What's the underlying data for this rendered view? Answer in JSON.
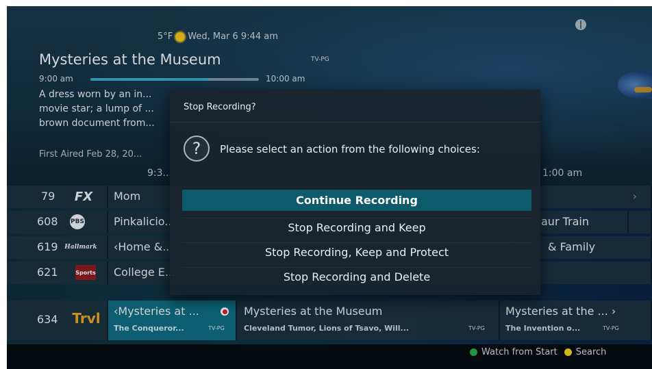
{
  "header": {
    "temperature": "5°F",
    "date_time": "Wed, Mar 6 9:44 am",
    "title": "Mysteries at the Museum",
    "rating": "TV-PG",
    "start_time": "9:00 am",
    "end_time": "10:00 am",
    "progress_fraction": 0.7,
    "description": "A dress worn by an in... movie star; a lump of ... brown document from...",
    "first_aired": "First Aired Feb 28, 20..."
  },
  "timeline": {
    "slot_1": "9:3...",
    "slot_2": "1:00 am"
  },
  "guide": {
    "rows": [
      {
        "channel": "79",
        "logo": "FX",
        "program": "Mom",
        "right": "",
        "chevron": "›"
      },
      {
        "channel": "608",
        "logo": "PBS",
        "program": "Pinkalicio...",
        "right": "aur Train",
        "chevron": ""
      },
      {
        "channel": "619",
        "logo": "Hallmark",
        "program": "‹Home &...",
        "right": "& Family",
        "chevron": "›"
      },
      {
        "channel": "621",
        "logo": "Sports",
        "program": "College E...",
        "right": "",
        "chevron": ""
      }
    ],
    "row_634": {
      "channel": "634",
      "logo": "Trvl",
      "cells": [
        {
          "title": "‹Mysteries at ...",
          "subtitle": "The Conqueror...",
          "rating": "TV-PG",
          "recording": true
        },
        {
          "title": "Mysteries at the Museum",
          "subtitle": "Cleveland Tumor, Lions of Tsavo, Will...",
          "rating": "TV-PG"
        },
        {
          "title": "Mysteries at the ... ›",
          "subtitle": "The Invention o...",
          "rating": "TV-PG"
        }
      ]
    }
  },
  "footer": {
    "watch_from_start": "Watch from Start",
    "search": "Search",
    "green_color": "#2aa84a",
    "yellow_color": "#f0cf1c"
  },
  "dialog": {
    "title": "Stop Recording?",
    "message": "Please select an action from the following choices:",
    "icon": "question-mark-icon",
    "buttons": {
      "continue": "Continue Recording",
      "keep": "Stop Recording and Keep",
      "protect": "Stop Recording, Keep and Protect",
      "delete": "Stop Recording and Delete"
    },
    "accent": "#0d5a6b"
  }
}
